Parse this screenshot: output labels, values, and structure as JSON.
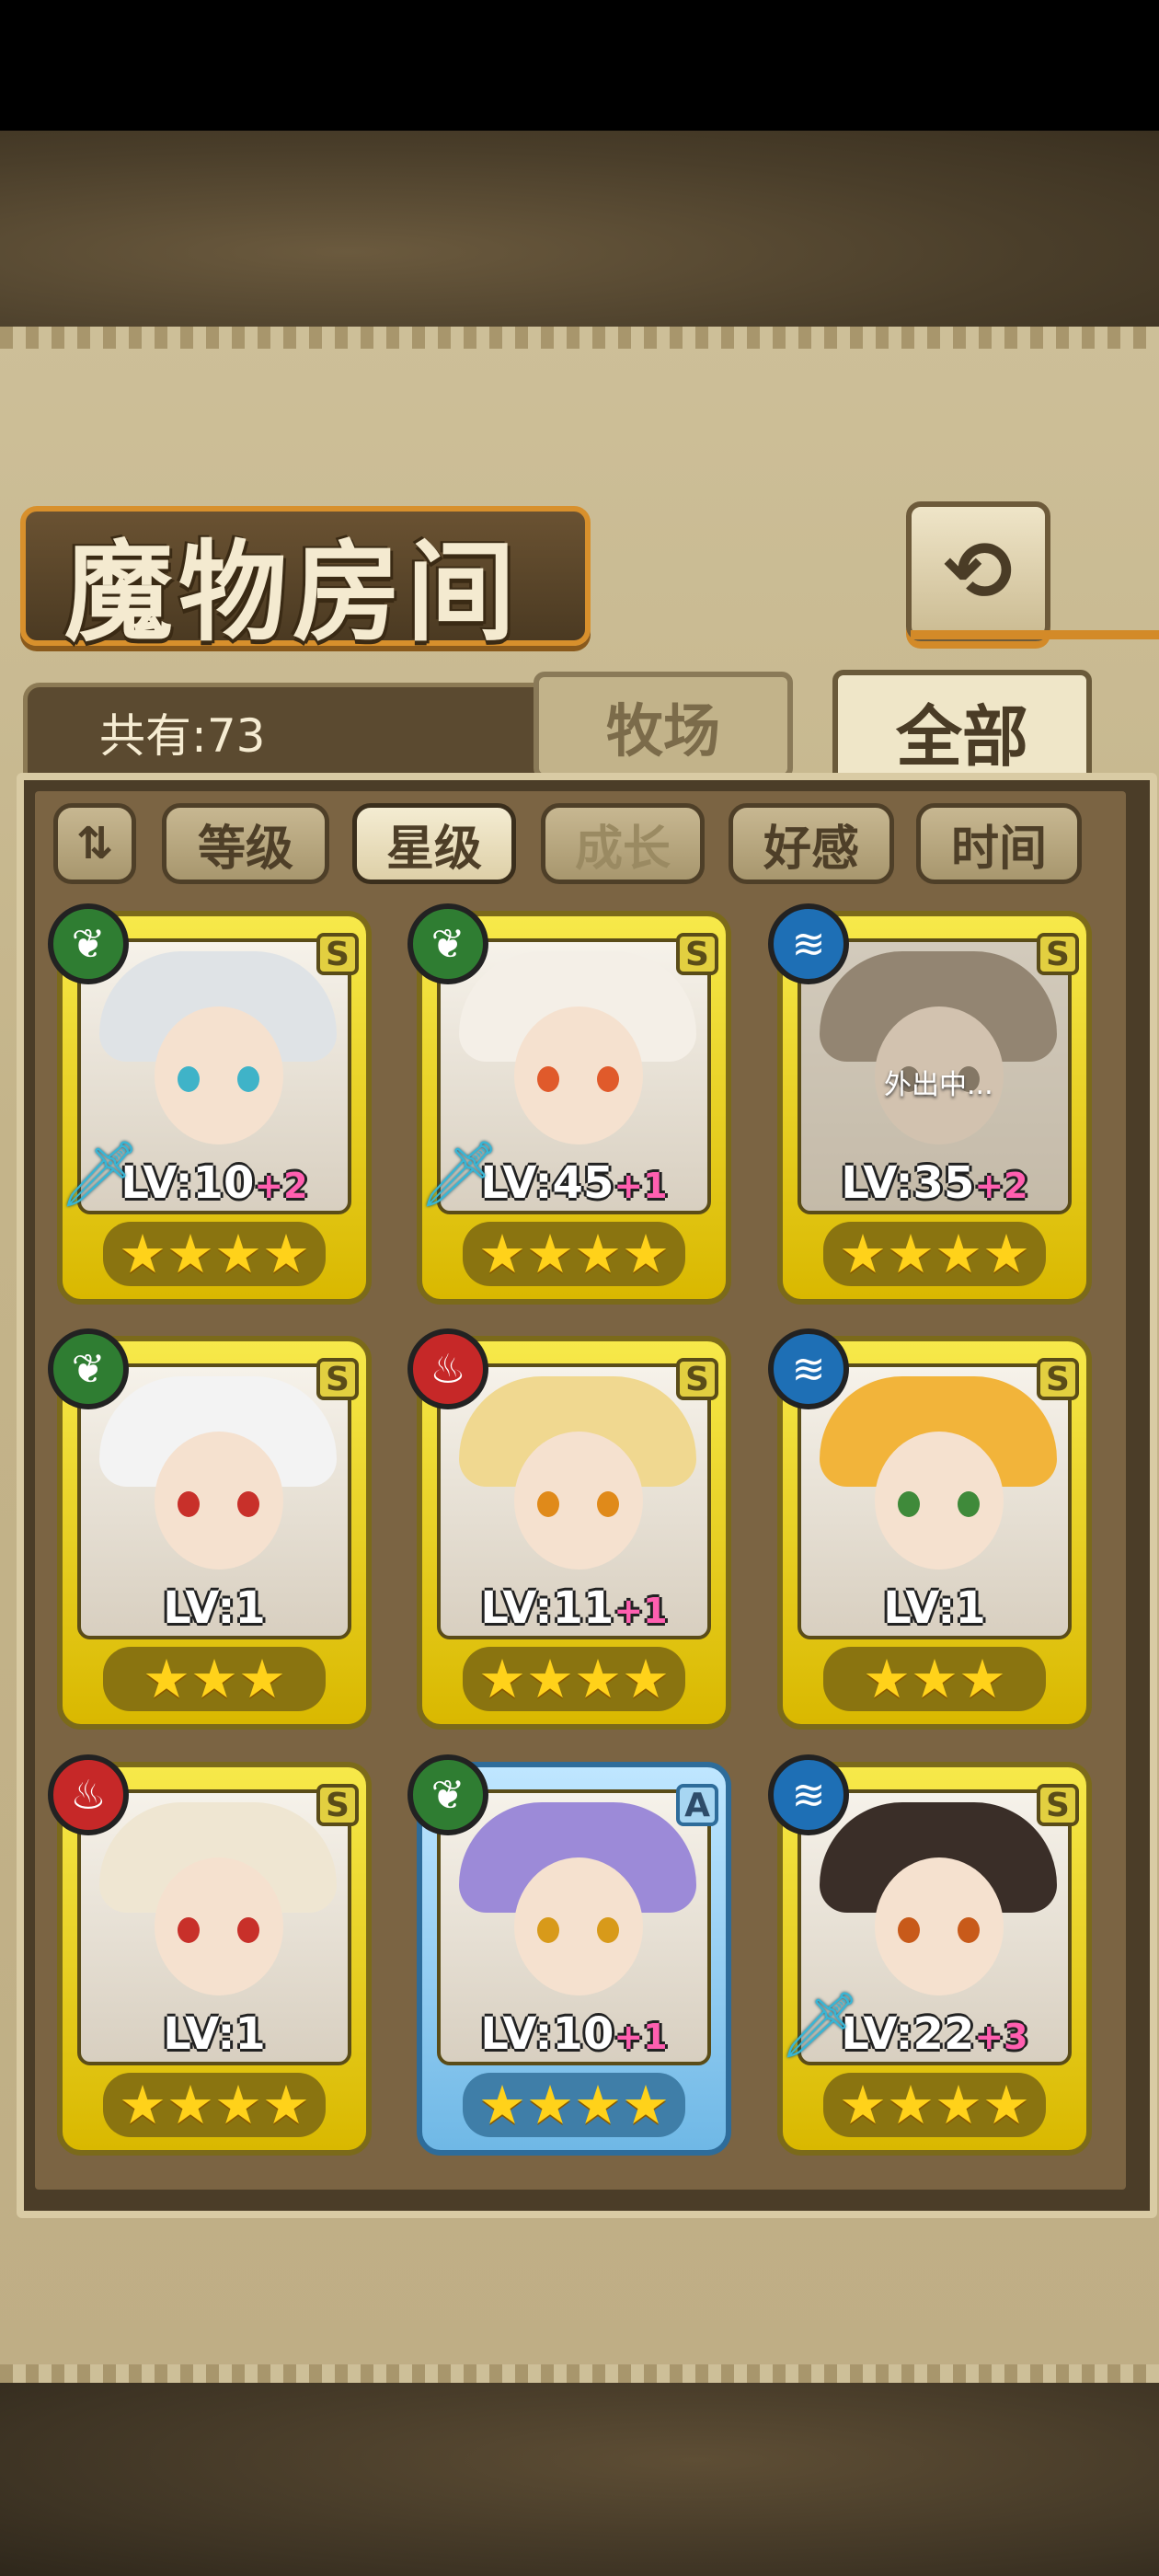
{
  "title": "魔物房间",
  "back_icon_glyph": "⟲",
  "count_text": "共有:73",
  "tabs": {
    "farm": "牧场",
    "all": "全部"
  },
  "filters": {
    "sort_glyph": "⇅",
    "items": [
      "等级",
      "星级",
      "成长",
      "好感",
      "时间"
    ]
  },
  "cards": [
    {
      "element": "grass",
      "element_glyph": "❦",
      "rank": "S",
      "level": "LV:10",
      "plus": "+2",
      "stars": "★★★★",
      "weapon": true,
      "hair": "#dfe3e6",
      "eyes": "#3fb3c8",
      "outing": ""
    },
    {
      "element": "grass",
      "element_glyph": "❦",
      "rank": "S",
      "level": "LV:45",
      "plus": "+1",
      "stars": "★★★★",
      "weapon": true,
      "hair": "#f4efe7",
      "eyes": "#e05a2b",
      "outing": ""
    },
    {
      "element": "water",
      "element_glyph": "≋",
      "rank": "S",
      "level": "LV:35",
      "plus": "+2",
      "stars": "★★★★",
      "weapon": false,
      "hair": "#6c5a48",
      "eyes": "#4a3a2a",
      "outing": "外出中..."
    },
    {
      "element": "grass",
      "element_glyph": "❦",
      "rank": "S",
      "level": "LV:1",
      "plus": "",
      "stars": "★★★",
      "weapon": false,
      "hair": "#f3f3f3",
      "eyes": "#c8302a",
      "outing": ""
    },
    {
      "element": "fire",
      "element_glyph": "♨",
      "rank": "S",
      "level": "LV:11",
      "plus": "+1",
      "stars": "★★★★",
      "weapon": false,
      "hair": "#f0d890",
      "eyes": "#e08a1a",
      "outing": ""
    },
    {
      "element": "water",
      "element_glyph": "≋",
      "rank": "S",
      "level": "LV:1",
      "plus": "",
      "stars": "★★★",
      "weapon": false,
      "hair": "#f2b43a",
      "eyes": "#3f8a3a",
      "outing": ""
    },
    {
      "element": "fire",
      "element_glyph": "♨",
      "rank": "S",
      "level": "LV:1",
      "plus": "",
      "stars": "★★★★",
      "weapon": false,
      "hair": "#efe6d2",
      "eyes": "#c8302a",
      "outing": ""
    },
    {
      "element": "grass",
      "element_glyph": "❦",
      "rank": "A",
      "level": "LV:10",
      "plus": "+1",
      "stars": "★★★★",
      "weapon": false,
      "hair": "#9c8ad8",
      "eyes": "#d89a1a",
      "outing": "",
      "frame": "blue"
    },
    {
      "element": "water",
      "element_glyph": "≋",
      "rank": "S",
      "level": "LV:22",
      "plus": "+3",
      "stars": "★★★★",
      "weapon": true,
      "hair": "#3a2e28",
      "eyes": "#c85a1a",
      "outing": ""
    }
  ]
}
